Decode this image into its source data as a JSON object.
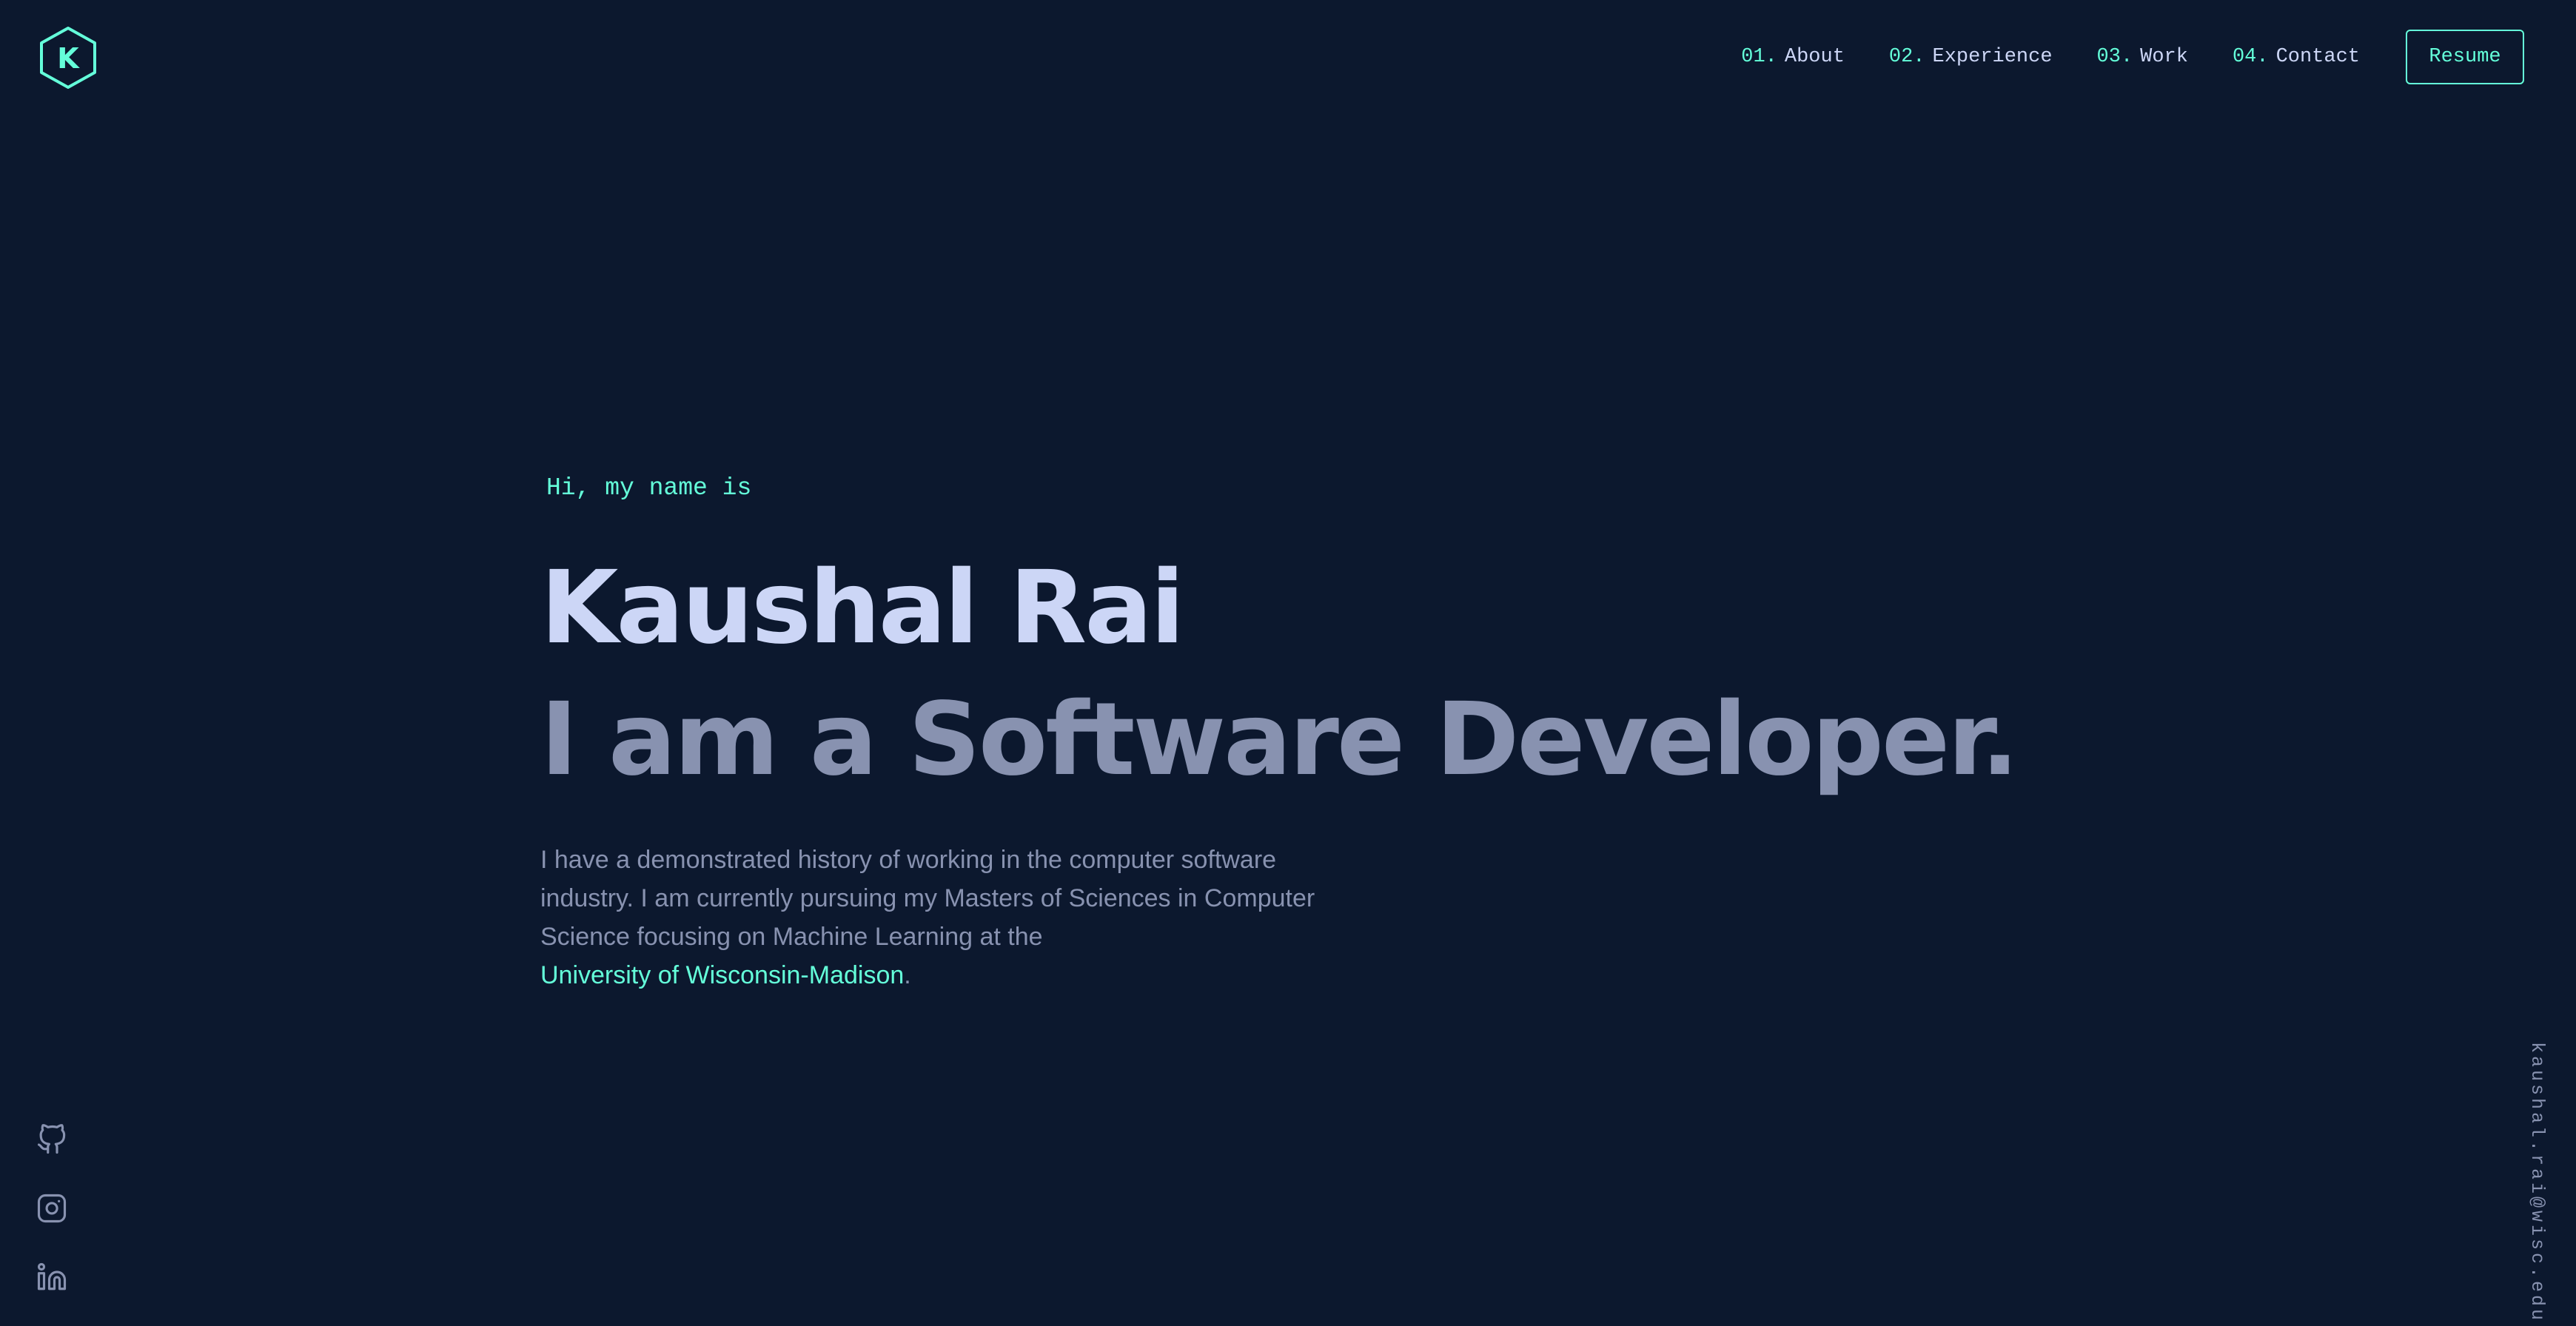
{
  "logo": {
    "letter": "K",
    "icon": "hexagon-logo-icon"
  },
  "nav": {
    "items": [
      {
        "num": "01.",
        "label": "About"
      },
      {
        "num": "02.",
        "label": "Experience"
      },
      {
        "num": "03.",
        "label": "Work"
      },
      {
        "num": "04.",
        "label": "Contact"
      }
    ],
    "resume_label": "Resume"
  },
  "hero": {
    "greeting": "Hi, my name is",
    "name": "Kaushal Rai",
    "role": "I am a Software Developer.",
    "description": "I have a demonstrated history of working in the computer software industry. I am currently pursuing my Masters of Sciences in Computer Science focusing on Machine Learning at the",
    "link_text": "University of Wisconsin-Madison",
    "link_suffix": "."
  },
  "socials": [
    {
      "icon": "github-icon"
    },
    {
      "icon": "instagram-icon"
    },
    {
      "icon": "linkedin-icon"
    }
  ],
  "email": "kaushal.rai@wisc.edu",
  "colors": {
    "background": "#0c182e",
    "accent": "#64ffda",
    "heading": "#ccd6f6",
    "text": "#8892b0"
  }
}
